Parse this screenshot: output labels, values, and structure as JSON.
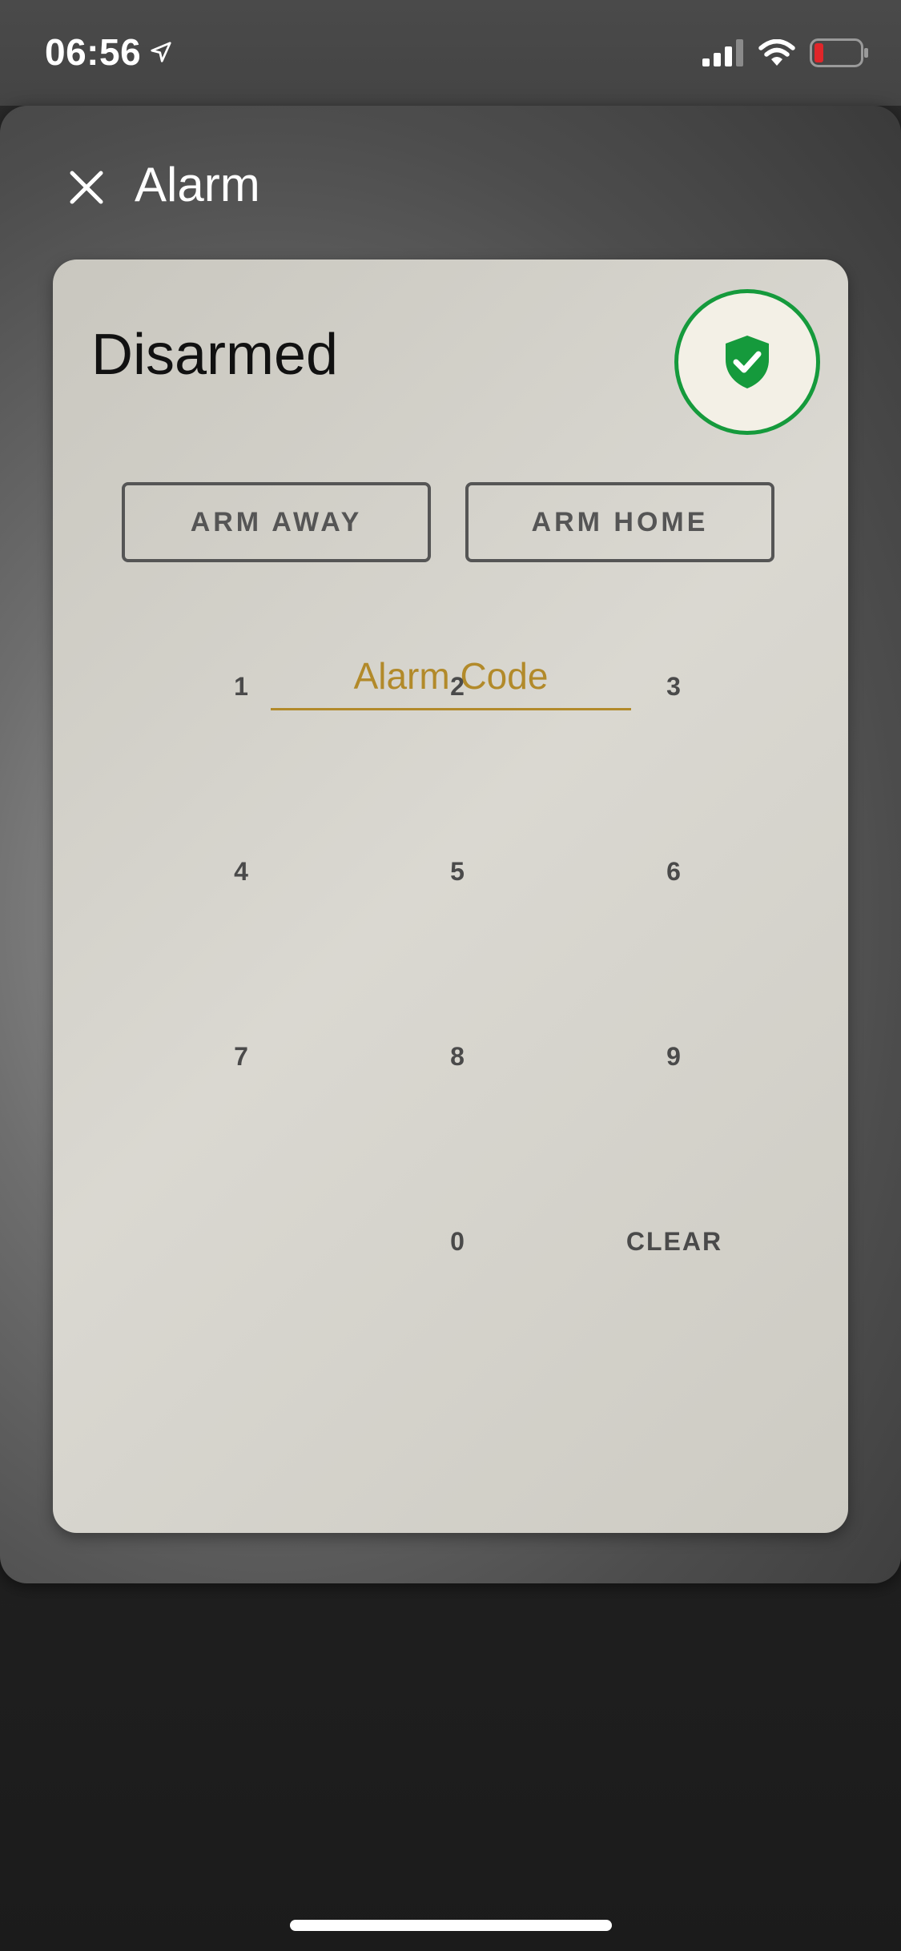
{
  "status_bar": {
    "time": "06:56"
  },
  "icons": {
    "location": "location-arrow-icon",
    "signal": "signal-bars-icon",
    "wifi": "wifi-icon",
    "battery": "battery-low-icon",
    "close": "close-icon",
    "shield": "shield-check-icon"
  },
  "colors": {
    "accent_gold": "#b28a2a",
    "status_green": "#159a3c",
    "battery_red": "#e0262a"
  },
  "dialog": {
    "title": "Alarm"
  },
  "alarm": {
    "state": "Disarmed",
    "arm_away_label": "ARM AWAY",
    "arm_home_label": "ARM HOME",
    "code_placeholder": "Alarm Code"
  },
  "keypad": {
    "keys": [
      "1",
      "2",
      "3",
      "4",
      "5",
      "6",
      "7",
      "8",
      "9",
      "",
      "0",
      "CLEAR"
    ]
  }
}
